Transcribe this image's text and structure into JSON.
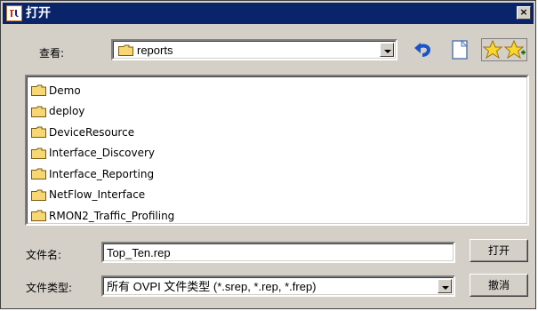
{
  "window": {
    "title": "打开",
    "close_label": "×",
    "icon": "app-logo-icon"
  },
  "look_in": {
    "label": "查看:",
    "value": "reports",
    "icon": "folder-icon"
  },
  "toolbar": {
    "items": [
      "back-icon",
      "new-folder-icon",
      "favorites-icon"
    ]
  },
  "file_list": {
    "items": [
      {
        "name": "Demo",
        "icon": "folder-icon"
      },
      {
        "name": "deploy",
        "icon": "folder-icon"
      },
      {
        "name": "DeviceResource",
        "icon": "folder-icon"
      },
      {
        "name": "Interface_Discovery",
        "icon": "folder-icon"
      },
      {
        "name": "Interface_Reporting",
        "icon": "folder-icon"
      },
      {
        "name": "NetFlow_Interface",
        "icon": "folder-icon"
      },
      {
        "name": "RMON2_Traffic_Profiling",
        "icon": "folder-icon"
      }
    ]
  },
  "filename": {
    "label": "文件名:",
    "value": "Top_Ten.rep"
  },
  "filetype": {
    "label": "文件类型:",
    "value": "所有 OVPI 文件类型 (*.srep, *.rep, *.frep)"
  },
  "buttons": {
    "open": "打开",
    "cancel": "撤消"
  },
  "colors": {
    "titlebar": "#0a246a",
    "dialog_bg": "#d4d0c8",
    "folder_yellow": "#f7d774"
  }
}
